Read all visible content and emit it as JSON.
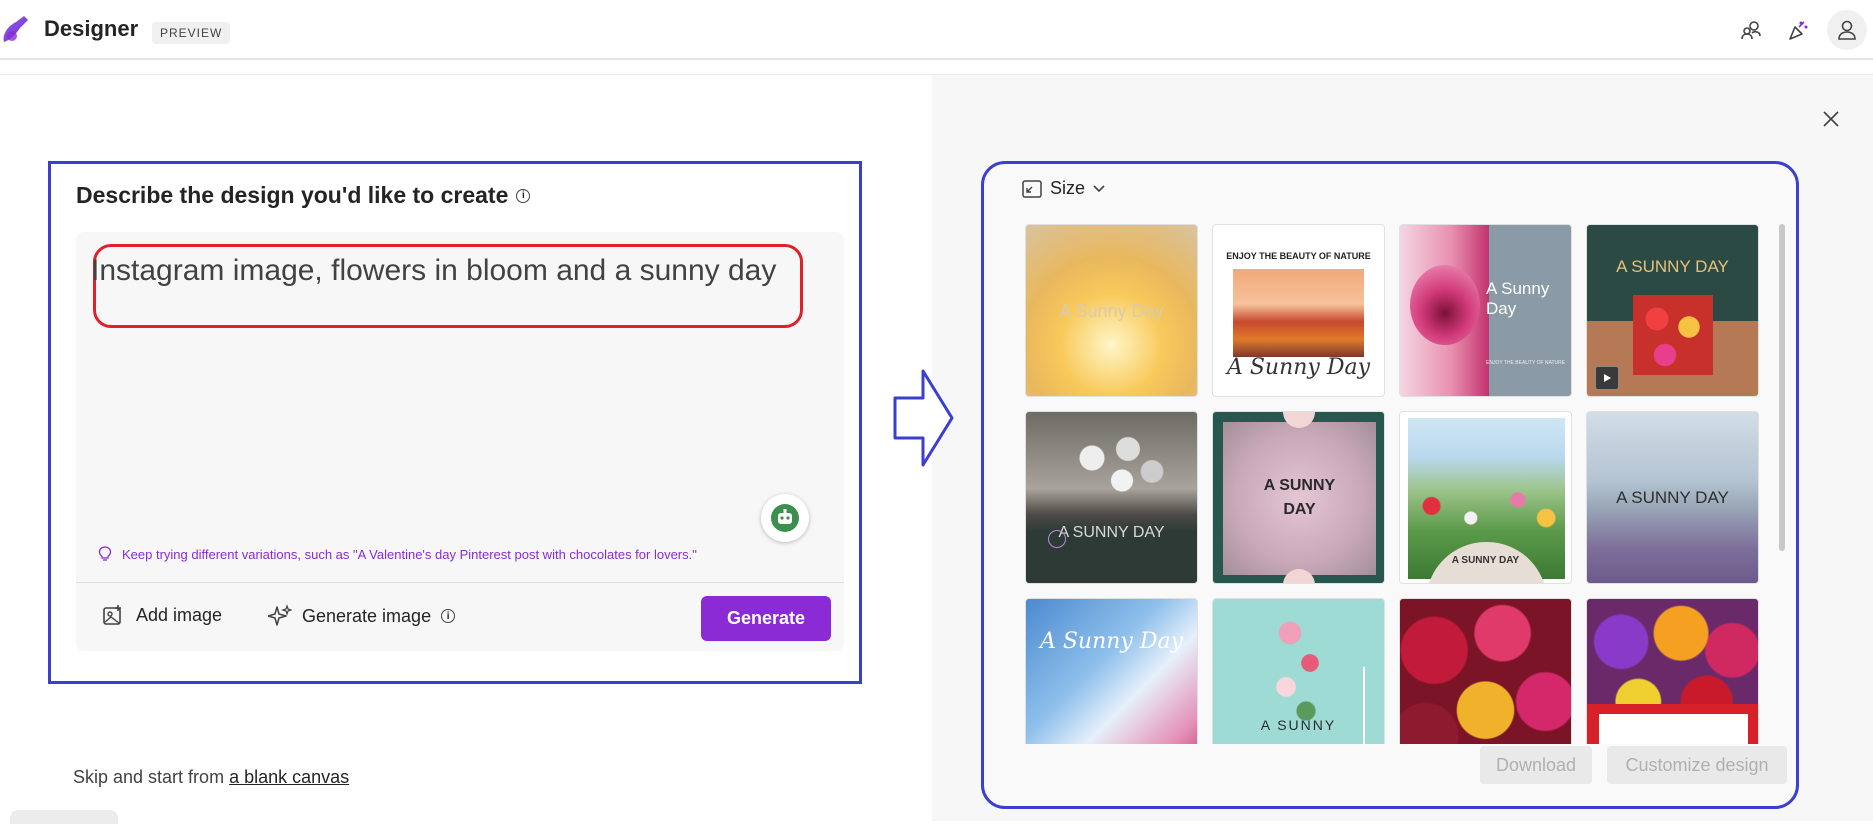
{
  "header": {
    "app_name": "Designer",
    "badge": "PREVIEW"
  },
  "prompt_panel": {
    "heading": "Describe the design you'd like to create",
    "info_glyph": "i",
    "prompt_value": "Instagram image, flowers in bloom and a sunny day",
    "tip": "Keep trying different variations, such as \"A Valentine's day Pinterest post with chocolates for lovers.\"",
    "add_image_label": "Add image",
    "generate_image_label": "Generate image",
    "generate_button": "Generate"
  },
  "skip": {
    "prefix": "Skip and start from ",
    "link": "a blank canvas"
  },
  "results": {
    "size_label": "Size",
    "thumbnails": [
      {
        "text": "A Sunny Day"
      },
      {
        "text": "ENJOY THE BEAUTY OF NATURE",
        "script": "A Sunny Day"
      },
      {
        "text": "A Sunny Day",
        "small": "ENJOY THE BEAUTY OF NATURE"
      },
      {
        "text": "A SUNNY DAY"
      },
      {
        "text": "A SUNNY DAY"
      },
      {
        "text": "A SUNNY DAY"
      },
      {
        "text": "A SUNNY DAY"
      },
      {
        "text": "A SUNNY DAY"
      },
      {
        "text": "A Sunny Day"
      },
      {
        "text": "A SUNNY"
      },
      {
        "text": ""
      },
      {
        "text": ""
      }
    ],
    "download_button": "Download",
    "customize_button": "Customize design"
  },
  "colors": {
    "accent": "#8b2bd5",
    "annotation_blue": "#3b3fd1",
    "annotation_red": "#e0202b"
  }
}
